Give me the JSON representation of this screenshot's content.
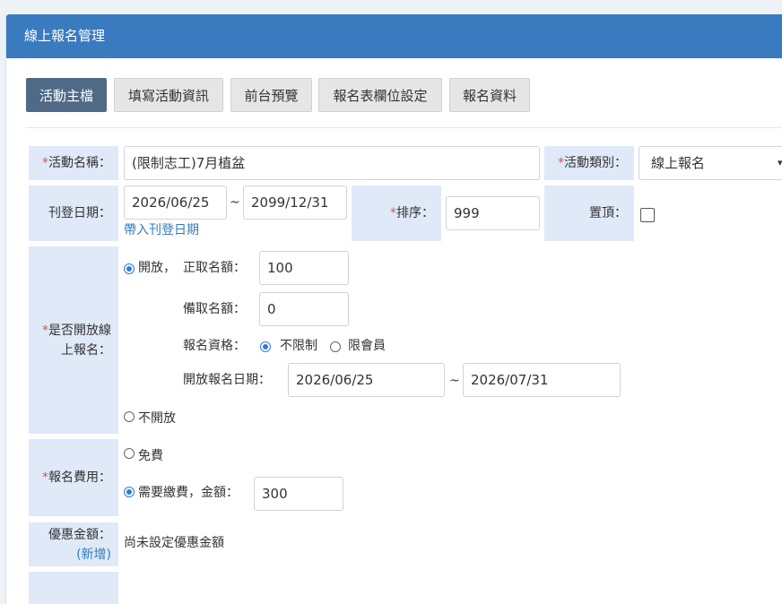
{
  "header": {
    "title": "線上報名管理"
  },
  "tabs": [
    {
      "label": "活動主檔",
      "active": true
    },
    {
      "label": "填寫活動資訊",
      "active": false
    },
    {
      "label": "前台預覽",
      "active": false
    },
    {
      "label": "報名表欄位設定",
      "active": false
    },
    {
      "label": "報名資料",
      "active": false
    }
  ],
  "form": {
    "required_mark": "*",
    "activity_name": {
      "label": "活動名稱：",
      "value": "(限制志工)7月植盆"
    },
    "activity_type": {
      "label": "活動類別：",
      "value": "線上報名"
    },
    "publish_date": {
      "label": "刊登日期：",
      "start": "2026/06/25",
      "separator": "~",
      "end": "2099/12/31",
      "link": "帶入刊登日期"
    },
    "order": {
      "label": "排序：",
      "value": "999"
    },
    "pin_top": {
      "label": "置頂：",
      "checked": false
    },
    "online_signup": {
      "label_line1": "是否開放線",
      "label_line2": "上報名：",
      "open_label": "開放，",
      "quota_label": "正取名額：",
      "quota_value": "100",
      "waitlist_label": "備取名額：",
      "waitlist_value": "0",
      "eligibility_label": "報名資格：",
      "eligibility_unlimited": "不限制",
      "eligibility_members": "限會員",
      "signup_dates_label": "開放報名日期：",
      "signup_start": "2026/06/25",
      "signup_separator": "~",
      "signup_end": "2026/07/31",
      "closed_label": "不開放"
    },
    "fee": {
      "label": "報名費用：",
      "free_label": "免費",
      "paid_label": "需要繳費，金額：",
      "amount": "300"
    },
    "discount": {
      "label": "優惠金額：",
      "add_link": "(新增)",
      "empty_text": "尚未設定優惠金額"
    }
  }
}
